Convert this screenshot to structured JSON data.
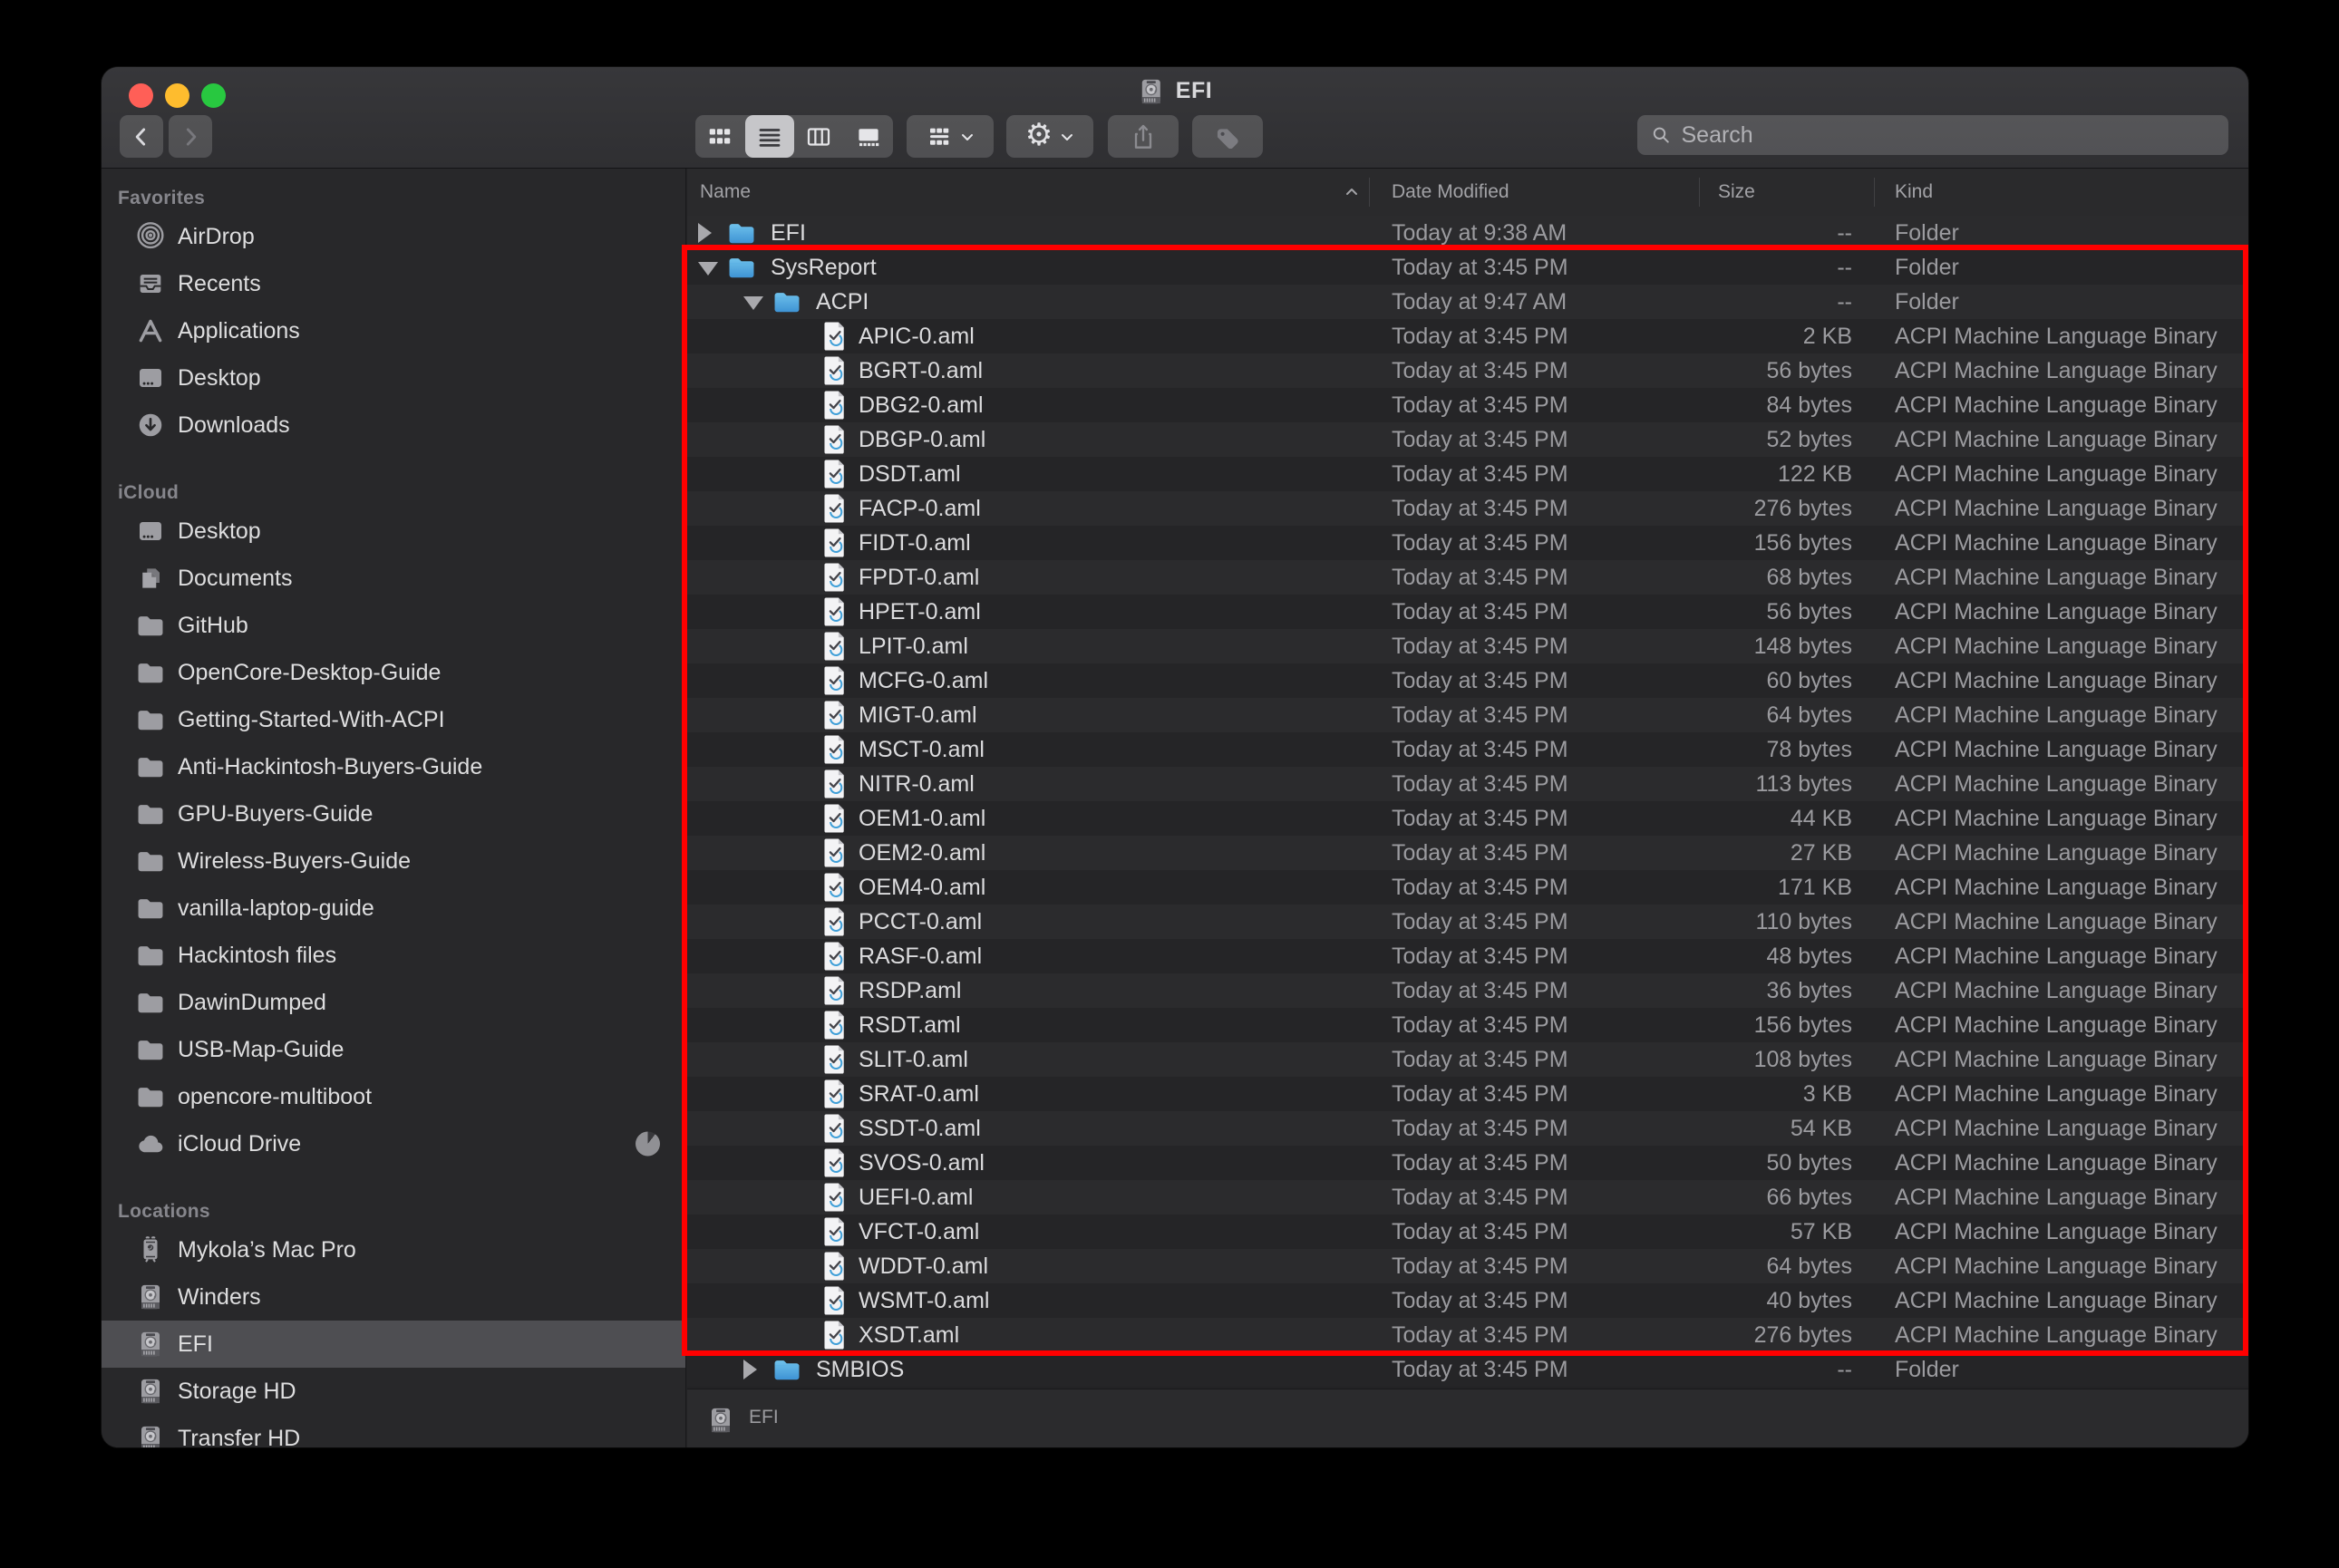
{
  "window": {
    "title": "EFI"
  },
  "toolbar": {
    "search_placeholder": "Search",
    "view_modes": [
      "icon-view",
      "list-view",
      "column-view",
      "gallery-view"
    ],
    "selected_view": "list-view",
    "icons": [
      "back-icon",
      "forward-icon",
      "grid-icon",
      "list-icon",
      "columns-icon",
      "gallery-icon",
      "group-icon",
      "gear-icon",
      "share-icon",
      "tag-icon",
      "search-icon",
      "chevron-down-icon"
    ]
  },
  "columns": {
    "name": "Name",
    "date": "Date Modified",
    "size": "Size",
    "kind": "Kind",
    "sort_indicator": "ascending"
  },
  "sidebar": {
    "sections": [
      {
        "label": "Favorites",
        "items": [
          {
            "label": "AirDrop",
            "icon": "airdrop"
          },
          {
            "label": "Recents",
            "icon": "recents"
          },
          {
            "label": "Applications",
            "icon": "applications"
          },
          {
            "label": "Desktop",
            "icon": "desktop"
          },
          {
            "label": "Downloads",
            "icon": "downloads"
          }
        ]
      },
      {
        "label": "iCloud",
        "items": [
          {
            "label": "Desktop",
            "icon": "desktop"
          },
          {
            "label": "Documents",
            "icon": "documents"
          },
          {
            "label": "GitHub",
            "icon": "folder"
          },
          {
            "label": "OpenCore-Desktop-Guide",
            "icon": "folder"
          },
          {
            "label": "Getting-Started-With-ACPI",
            "icon": "folder"
          },
          {
            "label": "Anti-Hackintosh-Buyers-Guide",
            "icon": "folder"
          },
          {
            "label": "GPU-Buyers-Guide",
            "icon": "folder"
          },
          {
            "label": "Wireless-Buyers-Guide",
            "icon": "folder"
          },
          {
            "label": "vanilla-laptop-guide",
            "icon": "folder"
          },
          {
            "label": "Hackintosh files",
            "icon": "folder"
          },
          {
            "label": "DawinDumped",
            "icon": "folder"
          },
          {
            "label": "USB-Map-Guide",
            "icon": "folder"
          },
          {
            "label": "opencore-multiboot",
            "icon": "folder"
          },
          {
            "label": "iCloud Drive",
            "icon": "cloud",
            "indicator": "sync-pie"
          }
        ]
      },
      {
        "label": "Locations",
        "items": [
          {
            "label": "Mykola’s Mac Pro",
            "icon": "macpro"
          },
          {
            "label": "Winders",
            "icon": "disk"
          },
          {
            "label": "EFI",
            "icon": "disk",
            "selected": true
          },
          {
            "label": "Storage HD",
            "icon": "disk"
          },
          {
            "label": "Transfer HD",
            "icon": "disk"
          }
        ]
      }
    ]
  },
  "rows": [
    {
      "name": "EFI",
      "date": "Today at 9:38 AM",
      "size": "--",
      "kind": "Folder",
      "level": 0,
      "icon": "folder-blue",
      "disclosure": "right"
    },
    {
      "name": "SysReport",
      "date": "Today at 3:45 PM",
      "size": "--",
      "kind": "Folder",
      "level": 0,
      "icon": "folder-blue",
      "disclosure": "down"
    },
    {
      "name": "ACPI",
      "date": "Today at 9:47 AM",
      "size": "--",
      "kind": "Folder",
      "level": 1,
      "icon": "folder-blue",
      "disclosure": "down"
    },
    {
      "name": "APIC-0.aml",
      "date": "Today at 3:45 PM",
      "size": "2 KB",
      "kind": "ACPI Machine Language Binary",
      "level": 2,
      "icon": "aml"
    },
    {
      "name": "BGRT-0.aml",
      "date": "Today at 3:45 PM",
      "size": "56 bytes",
      "kind": "ACPI Machine Language Binary",
      "level": 2,
      "icon": "aml"
    },
    {
      "name": "DBG2-0.aml",
      "date": "Today at 3:45 PM",
      "size": "84 bytes",
      "kind": "ACPI Machine Language Binary",
      "level": 2,
      "icon": "aml"
    },
    {
      "name": "DBGP-0.aml",
      "date": "Today at 3:45 PM",
      "size": "52 bytes",
      "kind": "ACPI Machine Language Binary",
      "level": 2,
      "icon": "aml"
    },
    {
      "name": "DSDT.aml",
      "date": "Today at 3:45 PM",
      "size": "122 KB",
      "kind": "ACPI Machine Language Binary",
      "level": 2,
      "icon": "aml"
    },
    {
      "name": "FACP-0.aml",
      "date": "Today at 3:45 PM",
      "size": "276 bytes",
      "kind": "ACPI Machine Language Binary",
      "level": 2,
      "icon": "aml"
    },
    {
      "name": "FIDT-0.aml",
      "date": "Today at 3:45 PM",
      "size": "156 bytes",
      "kind": "ACPI Machine Language Binary",
      "level": 2,
      "icon": "aml"
    },
    {
      "name": "FPDT-0.aml",
      "date": "Today at 3:45 PM",
      "size": "68 bytes",
      "kind": "ACPI Machine Language Binary",
      "level": 2,
      "icon": "aml"
    },
    {
      "name": "HPET-0.aml",
      "date": "Today at 3:45 PM",
      "size": "56 bytes",
      "kind": "ACPI Machine Language Binary",
      "level": 2,
      "icon": "aml"
    },
    {
      "name": "LPIT-0.aml",
      "date": "Today at 3:45 PM",
      "size": "148 bytes",
      "kind": "ACPI Machine Language Binary",
      "level": 2,
      "icon": "aml"
    },
    {
      "name": "MCFG-0.aml",
      "date": "Today at 3:45 PM",
      "size": "60 bytes",
      "kind": "ACPI Machine Language Binary",
      "level": 2,
      "icon": "aml"
    },
    {
      "name": "MIGT-0.aml",
      "date": "Today at 3:45 PM",
      "size": "64 bytes",
      "kind": "ACPI Machine Language Binary",
      "level": 2,
      "icon": "aml"
    },
    {
      "name": "MSCT-0.aml",
      "date": "Today at 3:45 PM",
      "size": "78 bytes",
      "kind": "ACPI Machine Language Binary",
      "level": 2,
      "icon": "aml"
    },
    {
      "name": "NITR-0.aml",
      "date": "Today at 3:45 PM",
      "size": "113 bytes",
      "kind": "ACPI Machine Language Binary",
      "level": 2,
      "icon": "aml"
    },
    {
      "name": "OEM1-0.aml",
      "date": "Today at 3:45 PM",
      "size": "44 KB",
      "kind": "ACPI Machine Language Binary",
      "level": 2,
      "icon": "aml"
    },
    {
      "name": "OEM2-0.aml",
      "date": "Today at 3:45 PM",
      "size": "27 KB",
      "kind": "ACPI Machine Language Binary",
      "level": 2,
      "icon": "aml"
    },
    {
      "name": "OEM4-0.aml",
      "date": "Today at 3:45 PM",
      "size": "171 KB",
      "kind": "ACPI Machine Language Binary",
      "level": 2,
      "icon": "aml"
    },
    {
      "name": "PCCT-0.aml",
      "date": "Today at 3:45 PM",
      "size": "110 bytes",
      "kind": "ACPI Machine Language Binary",
      "level": 2,
      "icon": "aml"
    },
    {
      "name": "RASF-0.aml",
      "date": "Today at 3:45 PM",
      "size": "48 bytes",
      "kind": "ACPI Machine Language Binary",
      "level": 2,
      "icon": "aml"
    },
    {
      "name": "RSDP.aml",
      "date": "Today at 3:45 PM",
      "size": "36 bytes",
      "kind": "ACPI Machine Language Binary",
      "level": 2,
      "icon": "aml"
    },
    {
      "name": "RSDT.aml",
      "date": "Today at 3:45 PM",
      "size": "156 bytes",
      "kind": "ACPI Machine Language Binary",
      "level": 2,
      "icon": "aml"
    },
    {
      "name": "SLIT-0.aml",
      "date": "Today at 3:45 PM",
      "size": "108 bytes",
      "kind": "ACPI Machine Language Binary",
      "level": 2,
      "icon": "aml"
    },
    {
      "name": "SRAT-0.aml",
      "date": "Today at 3:45 PM",
      "size": "3 KB",
      "kind": "ACPI Machine Language Binary",
      "level": 2,
      "icon": "aml"
    },
    {
      "name": "SSDT-0.aml",
      "date": "Today at 3:45 PM",
      "size": "54 KB",
      "kind": "ACPI Machine Language Binary",
      "level": 2,
      "icon": "aml"
    },
    {
      "name": "SVOS-0.aml",
      "date": "Today at 3:45 PM",
      "size": "50 bytes",
      "kind": "ACPI Machine Language Binary",
      "level": 2,
      "icon": "aml"
    },
    {
      "name": "UEFI-0.aml",
      "date": "Today at 3:45 PM",
      "size": "66 bytes",
      "kind": "ACPI Machine Language Binary",
      "level": 2,
      "icon": "aml"
    },
    {
      "name": "VFCT-0.aml",
      "date": "Today at 3:45 PM",
      "size": "57 KB",
      "kind": "ACPI Machine Language Binary",
      "level": 2,
      "icon": "aml"
    },
    {
      "name": "WDDT-0.aml",
      "date": "Today at 3:45 PM",
      "size": "64 bytes",
      "kind": "ACPI Machine Language Binary",
      "level": 2,
      "icon": "aml"
    },
    {
      "name": "WSMT-0.aml",
      "date": "Today at 3:45 PM",
      "size": "40 bytes",
      "kind": "ACPI Machine Language Binary",
      "level": 2,
      "icon": "aml"
    },
    {
      "name": "XSDT.aml",
      "date": "Today at 3:45 PM",
      "size": "276 bytes",
      "kind": "ACPI Machine Language Binary",
      "level": 2,
      "icon": "aml"
    },
    {
      "name": "SMBIOS",
      "date": "Today at 3:45 PM",
      "size": "--",
      "kind": "Folder",
      "level": 1,
      "icon": "folder-blue",
      "disclosure": "right"
    }
  ],
  "status_bar": {
    "label": "EFI",
    "icon": "disk"
  },
  "annotation": {
    "shape": "rectangle",
    "color": "#ff0000",
    "highlights": "SysReport folder contents"
  },
  "colors": {
    "window_chrome": "#333336",
    "row_even": "#2b2b2d",
    "row_odd": "#252527",
    "sidebar_bg": "#28282a",
    "selection": "#4e4e52",
    "folder_blue": "#4aa3dc",
    "traffic_red": "#ff5f57",
    "traffic_yellow": "#febc2e",
    "traffic_green": "#28c840"
  }
}
